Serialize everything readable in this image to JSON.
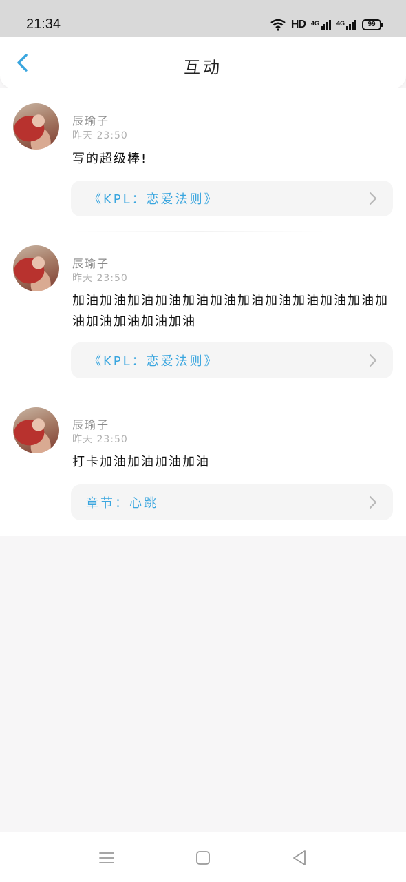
{
  "status_bar": {
    "time": "21:34",
    "network_hd": "HD",
    "network_type_1": "4G",
    "network_type_2": "4G",
    "battery": "99"
  },
  "header": {
    "title": "互动",
    "back_icon": "chevron-left-icon",
    "accent_color": "#3aa6df"
  },
  "comments": [
    {
      "user": "辰瑜子",
      "time": "昨天 23:50",
      "text": "写的超级棒!",
      "link": "《KPL：恋爱法则》"
    },
    {
      "user": "辰瑜子",
      "time": "昨天 23:50",
      "text": "加油加油加油加油加油加油加油加油加油加油加油加油加油加油加油加油",
      "link": "《KPL：恋爱法则》"
    },
    {
      "user": "辰瑜子",
      "time": "昨天 23:50",
      "text": "打卡加油加油加油加油",
      "link": "章节：心跳"
    }
  ],
  "nav_bar": {
    "menu_icon": "menu-icon",
    "home_icon": "home-square-icon",
    "back_icon": "back-triangle-icon"
  }
}
